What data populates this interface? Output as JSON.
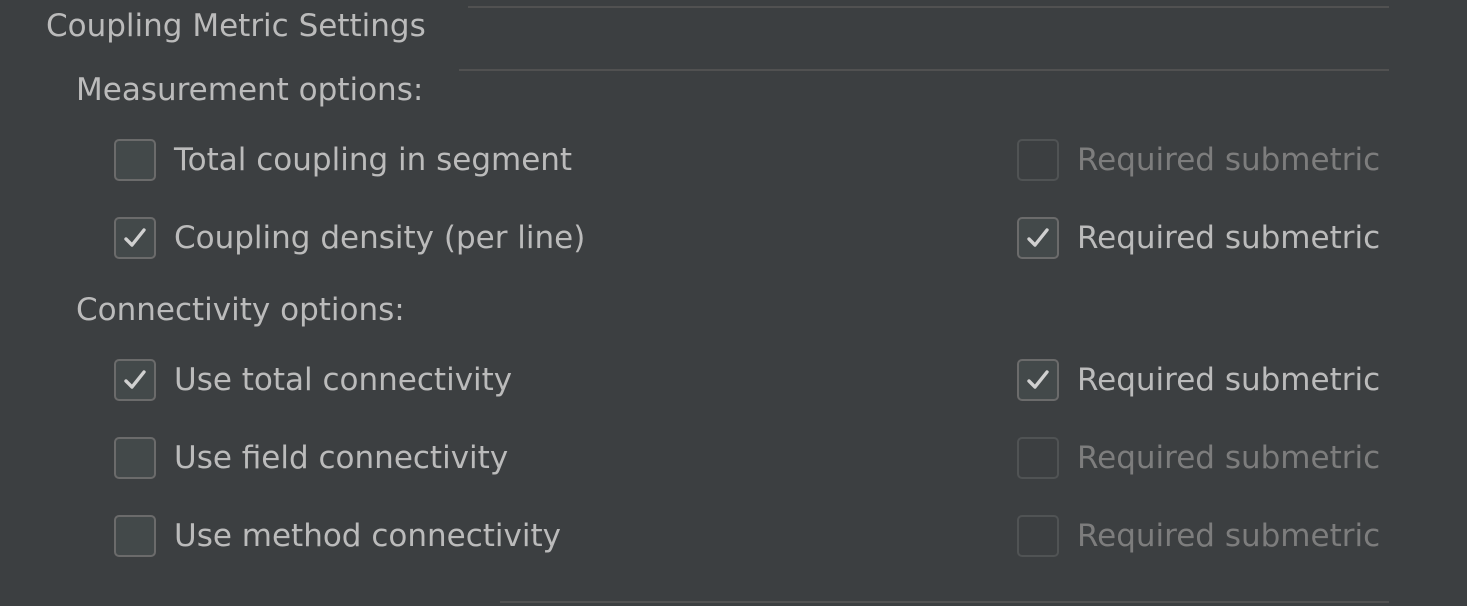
{
  "panel": {
    "title": "Coupling Metric Settings"
  },
  "measurement": {
    "label": "Measurement options:",
    "rows": [
      {
        "option_label": "Total coupling in segment",
        "option_checked": false,
        "required_label": "Required submetric",
        "required_checked": false,
        "required_enabled": false
      },
      {
        "option_label": "Coupling density (per line)",
        "option_checked": true,
        "required_label": "Required submetric",
        "required_checked": true,
        "required_enabled": true
      }
    ]
  },
  "connectivity": {
    "label": "Connectivity options:",
    "rows": [
      {
        "option_label": "Use total connectivity",
        "option_checked": true,
        "required_label": "Required submetric",
        "required_checked": true,
        "required_enabled": true
      },
      {
        "option_label": "Use field connectivity",
        "option_checked": false,
        "required_label": "Required submetric",
        "required_checked": false,
        "required_enabled": false
      },
      {
        "option_label": "Use method connectivity",
        "option_checked": false,
        "required_label": "Required submetric",
        "required_checked": false,
        "required_enabled": false
      }
    ]
  },
  "icons": {
    "check": "check-icon"
  },
  "colors": {
    "background": "#3c3f41",
    "text": "#bbbbbb",
    "disabled_text": "#7d7d7d",
    "checkbox_border": "#6b6b6b",
    "separator": "#515151"
  }
}
